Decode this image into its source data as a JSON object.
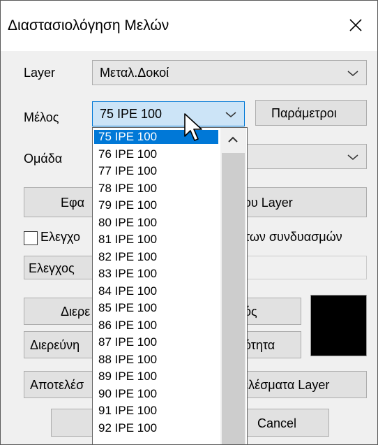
{
  "window": {
    "title": "Διαστασιολόγηση Μελών"
  },
  "form": {
    "layer_label": "Layer",
    "layer_value": "Μεταλ.Δοκοί",
    "member_label": "Μέλος",
    "member_value": "75 IPE 100",
    "params_button": "Παράμετροι",
    "group_label": "Ομάδα",
    "apply_left": "Εφα",
    "apply_right": "του Layer",
    "check_left": "Ελεγχο",
    "check_right": "των συνδυασμών",
    "check_button": "Ελεγχος",
    "investigate1_left": "Διερε",
    "investigate1_right": "ός",
    "investigate2_left": "Διερεύνη",
    "investigate2_right": "ότητα",
    "results_left": "Αποτελέσ",
    "results_right": "τελέσματα Layer",
    "cancel_button": "Cancel",
    "color_swatch": "#000000"
  },
  "dropdown": {
    "items": [
      "75 IPE 100",
      "76 IPE 100",
      "77 IPE 100",
      "78 IPE 100",
      "79 IPE 100",
      "80 IPE 100",
      "81 IPE 100",
      "82 IPE 100",
      "83 IPE 100",
      "84 IPE 100",
      "85 IPE 100",
      "86 IPE 100",
      "87 IPE 100",
      "88 IPE 100",
      "89 IPE 100",
      "90 IPE 100",
      "91 IPE 100",
      "92 IPE 100"
    ],
    "selected_index": 0
  },
  "icons": {
    "close": "close-icon",
    "chevron": "chevron-down-icon",
    "scroll_up": "chevron-up-icon",
    "cursor": "mouse-pointer-icon"
  }
}
